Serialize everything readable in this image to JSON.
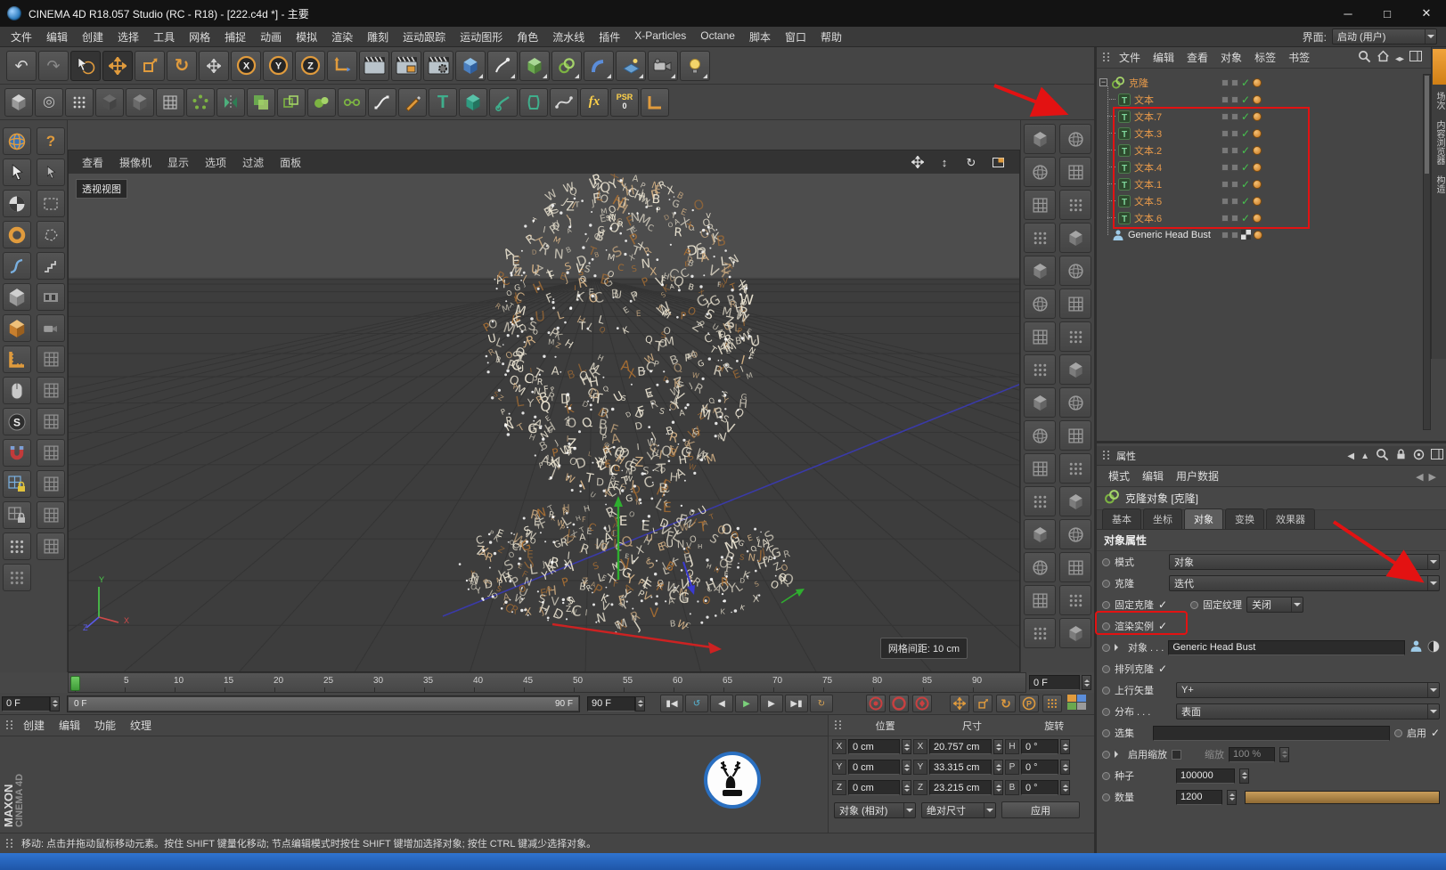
{
  "window": {
    "title": "CINEMA 4D R18.057 Studio (RC - R18) - [222.c4d *] - 主要",
    "minimize": "─",
    "maximize": "□",
    "close": "✕"
  },
  "menu_bar": {
    "items": [
      "文件",
      "编辑",
      "创建",
      "选择",
      "工具",
      "网格",
      "捕捉",
      "动画",
      "模拟",
      "渲染",
      "雕刻",
      "运动跟踪",
      "运动图形",
      "角色",
      "流水线",
      "插件",
      "X-Particles",
      "Octane",
      "脚本",
      "窗口",
      "帮助"
    ],
    "interface_label": "界面:",
    "interface_value": "启动 (用户)"
  },
  "toolbar_main": {
    "icons": [
      "undo",
      "redo",
      "live-selection",
      "move-tool",
      "scale-tool",
      "rotate-tool",
      "last-used-tool",
      "lock-x-axis",
      "lock-y-axis",
      "lock-z-axis",
      "coordinate-system",
      "render-view",
      "render-picture-viewer",
      "edit-render-settings",
      "add-cube-object",
      "add-pen-spline",
      "add-subdivision-surface",
      "add-mograph-object",
      "add-deformer",
      "add-environment",
      "add-camera",
      "add-light"
    ]
  },
  "toolbar_modeling": {
    "icons": [
      "make-editable",
      "current-state-to-object",
      "points-mode",
      "edges-mode",
      "polygons-mode",
      "workplane-mode",
      "array-object",
      "symmetry-object",
      "boole-object",
      "instance-object",
      "metaball-object",
      "connect-object",
      "spline-pen",
      "sketch-tool",
      "text-spline",
      "extrude-object",
      "sweep-object",
      "lathe-object",
      "bezier-tool",
      "xpresso-editor",
      "psr-reset",
      "measure-tool"
    ]
  },
  "left_palette": {
    "column_a": [
      "globe-icon",
      "pointer-icon",
      "checker-sphere-icon",
      "torus-icon",
      "spline-icon",
      "dice-icon",
      "cube-icon",
      "ruler-icon",
      "mouse-icon",
      "snap-badge-icon",
      "magnet-icon",
      "grid-lock-icon",
      "grid-lock-2-icon",
      "dot-grid-icon",
      "dot-grid-2-icon"
    ],
    "column_b": [
      "help-icon",
      "pointer-2-icon",
      "rect-select-icon",
      "poly-select-icon",
      "stairs-icon",
      "film-icon",
      "camera-2-icon",
      "hatch-icon",
      "hatch-icon",
      "hatch-icon",
      "hatch-icon",
      "hatch-icon",
      "hatch-icon",
      "hatch-icon"
    ]
  },
  "viewport": {
    "menus": [
      "查看",
      "摄像机",
      "显示",
      "选项",
      "过滤",
      "面板"
    ],
    "nav_icons": [
      "pan-view-icon",
      "zoom-view-icon",
      "rotate-view-icon",
      "toggle-view-icon"
    ],
    "view_label": "透视视图",
    "grid_label": "网格间距: 10 cm",
    "axis_labels": {
      "x": "X",
      "y": "Y",
      "z": "Z"
    }
  },
  "object_palettes": {
    "columns": 2,
    "cells_per_column": 16,
    "icon": "object-preset-icon"
  },
  "timeline": {
    "tick_labels": [
      "0",
      "5",
      "10",
      "15",
      "20",
      "25",
      "30",
      "35",
      "40",
      "45",
      "50",
      "55",
      "60",
      "65",
      "70",
      "75",
      "80",
      "85",
      "90"
    ],
    "current_frame_box": "0 F",
    "transport": {
      "current_frame": "0 F",
      "range_start": "0 F",
      "range_end": "90 F",
      "end_frame": "90 F",
      "buttons": [
        "goto-start",
        "loop-preview",
        "previous-frame",
        "play-forward",
        "next-frame",
        "goto-end",
        "play-mode"
      ],
      "record_buttons": [
        "record-objects",
        "autokey",
        "keyframe-selection"
      ],
      "key_buttons": [
        "key-position",
        "key-scale",
        "key-rotation",
        "key-parameter",
        "key-point-level"
      ]
    }
  },
  "object_manager": {
    "menus": [
      "文件",
      "编辑",
      "查看",
      "对象",
      "标签",
      "书签"
    ],
    "header_icons": [
      "search-icon",
      "home-icon",
      "path-icon",
      "panel-icon"
    ],
    "items": [
      {
        "label": "克隆",
        "icon": "cloner-icon",
        "level": 0,
        "expanded": true,
        "highlight": true
      },
      {
        "label": "文本",
        "icon": "text-object-icon",
        "level": 1,
        "highlight": true
      },
      {
        "label": "文本.7",
        "icon": "text-object-icon",
        "level": 1,
        "highlight": true
      },
      {
        "label": "文本.3",
        "icon": "text-object-icon",
        "level": 1,
        "highlight": true
      },
      {
        "label": "文本.2",
        "icon": "text-object-icon",
        "level": 1,
        "highlight": true
      },
      {
        "label": "文本.4",
        "icon": "text-object-icon",
        "level": 1,
        "highlight": true
      },
      {
        "label": "文本.1",
        "icon": "text-object-icon",
        "level": 1,
        "highlight": true
      },
      {
        "label": "文本.5",
        "icon": "text-object-icon",
        "level": 1,
        "highlight": true
      },
      {
        "label": "文本.6",
        "icon": "text-object-icon",
        "level": 1,
        "highlight": true
      },
      {
        "label": "Generic Head Bust",
        "icon": "figure-icon",
        "level": 0,
        "highlight": false,
        "texture_tag": true
      }
    ]
  },
  "side_tabs": {
    "labels": [
      "场次",
      "内容浏览器",
      "构造"
    ]
  },
  "attributes": {
    "panel_title": "属性",
    "menus": [
      "模式",
      "编辑",
      "用户数据"
    ],
    "object_header": "克隆对象 [克隆]",
    "tabs": [
      "基本",
      "坐标",
      "对象",
      "变换",
      "效果器"
    ],
    "active_tab": "对象",
    "section": "对象属性",
    "mode_label": "模式",
    "mode_value": "对象",
    "clone_label": "克隆",
    "clone_value": "迭代",
    "fix_clone_label": "固定克隆",
    "fix_texture_label": "固定纹理",
    "fix_texture_value": "关闭",
    "render_instance_label": "渲染实例",
    "object_label": "对象 . . .",
    "object_value": "Generic Head Bust",
    "align_clone_label": "排列克隆",
    "up_vector_label": "上行矢量",
    "up_vector_value": "Y+",
    "distribution_label": "分布 . . .",
    "distribution_value": "表面",
    "selection_label": "选集",
    "enable_label": "启用",
    "enable_scale_label": "启用缩放",
    "scale_label": "缩放",
    "scale_value": "100 %",
    "seed_label": "种子",
    "seed_value": "100000",
    "count_label": "数量",
    "count_value": "1200"
  },
  "coordinates": {
    "group_labels": [
      "位置",
      "尺寸",
      "旋转"
    ],
    "rows": [
      {
        "pl": "X",
        "pv": "0 cm",
        "sl": "X",
        "sv": "20.757 cm",
        "rl": "H",
        "rv": "0 °"
      },
      {
        "pl": "Y",
        "pv": "0 cm",
        "sl": "Y",
        "sv": "33.315 cm",
        "rl": "P",
        "rv": "0 °"
      },
      {
        "pl": "Z",
        "pv": "0 cm",
        "sl": "Z",
        "sv": "23.215 cm",
        "rl": "B",
        "rv": "0 °"
      }
    ],
    "position_mode": "对象 (相对)",
    "size_mode": "绝对尺寸",
    "apply_label": "应用"
  },
  "materials_panel": {
    "menus": [
      "创建",
      "编辑",
      "功能",
      "纹理"
    ],
    "brand_primary": "MAXON",
    "brand_secondary": "CINEMA 4D",
    "watermark": "deer-logo"
  },
  "status_bar": {
    "text": "移动: 点击并拖动鼠标移动元素。按住 SHIFT 键量化移动; 节点编辑模式时按住 SHIFT 键增加选择对象; 按住 CTRL 键减少选择对象。"
  },
  "annotations": {
    "color": "#e31212",
    "boxes": [
      "object-list-highlight",
      "render-instance-highlight"
    ],
    "arrows": [
      "arrow-to-object-list",
      "arrow-to-render-instance"
    ]
  },
  "colors": {
    "accent_orange": "#e09b3d",
    "check_green": "#46c24e",
    "selected_text": "#e89a4a"
  }
}
